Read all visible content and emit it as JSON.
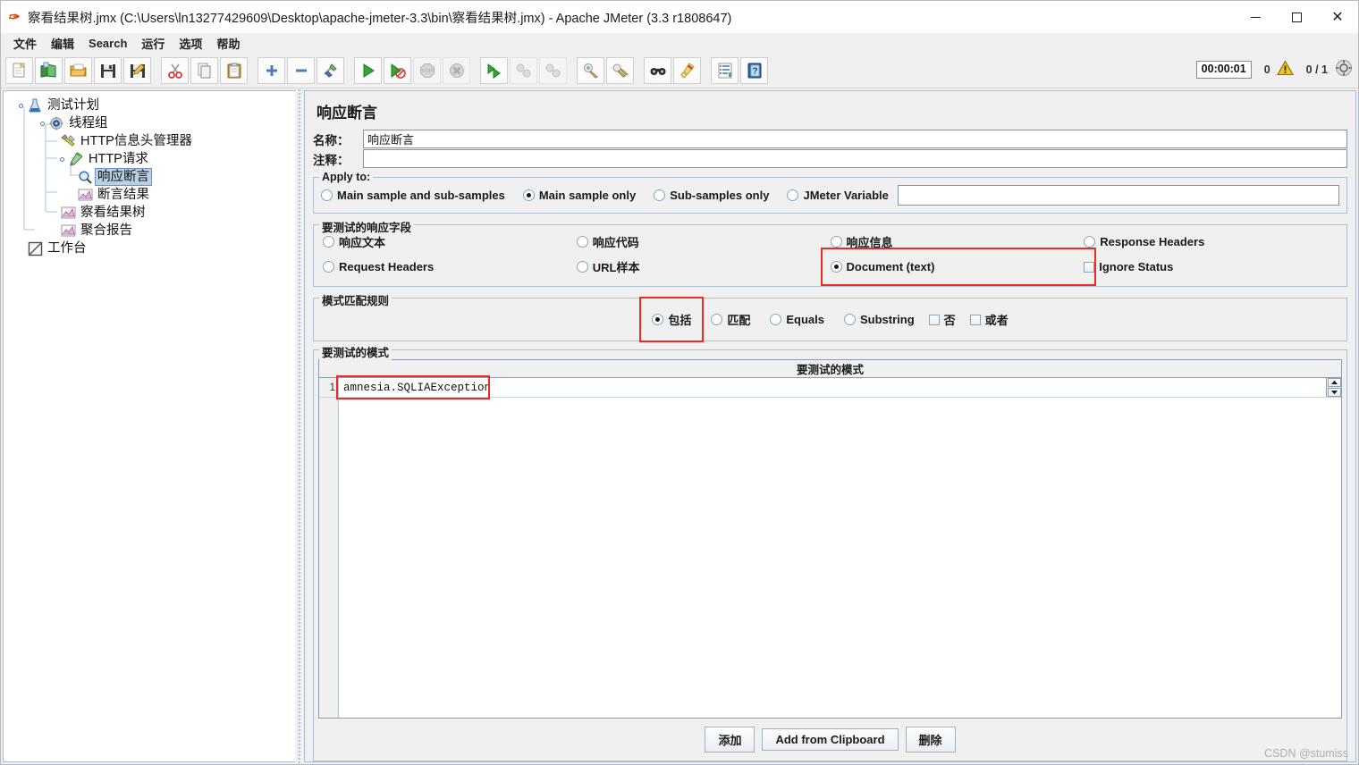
{
  "window": {
    "title": "察看结果树.jmx (C:\\Users\\ln13277429609\\Desktop\\apache-jmeter-3.3\\bin\\察看结果树.jmx) - Apache JMeter (3.3 r1808647)",
    "app_icon": "jmeter-feather-icon",
    "minimize_label": "",
    "maximize_label": "",
    "close_label": "✕"
  },
  "menubar": {
    "items": [
      {
        "label": "文件",
        "name": "menu-file"
      },
      {
        "label": "编辑",
        "name": "menu-edit"
      },
      {
        "label": "Search",
        "name": "menu-search"
      },
      {
        "label": "运行",
        "name": "menu-run"
      },
      {
        "label": "选项",
        "name": "menu-options"
      },
      {
        "label": "帮助",
        "name": "menu-help"
      }
    ]
  },
  "toolbar": {
    "buttons": [
      {
        "name": "new-icon",
        "group": 1
      },
      {
        "name": "templates-icon",
        "group": 1
      },
      {
        "name": "open-icon",
        "group": 1
      },
      {
        "name": "save-icon",
        "group": 1
      },
      {
        "name": "save-as-icon",
        "group": 1
      },
      {
        "name": "cut-icon",
        "group": 2
      },
      {
        "name": "copy-icon",
        "group": 2
      },
      {
        "name": "paste-icon",
        "group": 2
      },
      {
        "name": "expand-all-icon",
        "group": 3
      },
      {
        "name": "collapse-all-icon",
        "group": 3
      },
      {
        "name": "toggle-icon",
        "group": 3
      },
      {
        "name": "start-icon",
        "group": 4
      },
      {
        "name": "start-no-pause-icon",
        "group": 4
      },
      {
        "name": "stop-icon",
        "group": 4
      },
      {
        "name": "shutdown-icon",
        "group": 4
      },
      {
        "name": "start-remote-icon",
        "group": 5
      },
      {
        "name": "stop-remote-icon",
        "group": 5
      },
      {
        "name": "shutdown-remote-icon",
        "group": 5
      },
      {
        "name": "clear-icon",
        "group": 6
      },
      {
        "name": "clear-all-icon",
        "group": 6
      },
      {
        "name": "search-icon",
        "group": 7
      },
      {
        "name": "search-reset-icon",
        "group": 7
      },
      {
        "name": "function-helper-icon",
        "group": 8
      },
      {
        "name": "help-icon",
        "group": 8
      }
    ],
    "status": {
      "elapsed_time": "00:00:01",
      "warning_count": "0",
      "warning_icon": "warning-triangle-icon",
      "threads_ratio": "0 / 1",
      "remote_icon": "remote-status-icon"
    }
  },
  "tree": {
    "nodes": [
      {
        "label": "测试计划",
        "icon": "test-plan-icon",
        "depth": 0,
        "selected": false,
        "handle": true
      },
      {
        "label": "线程组",
        "icon": "thread-group-icon",
        "depth": 1,
        "selected": false,
        "handle": true
      },
      {
        "label": "HTTP信息头管理器",
        "icon": "header-manager-icon",
        "depth": 2,
        "selected": false,
        "handle": false
      },
      {
        "label": "HTTP请求",
        "icon": "http-request-icon",
        "depth": 2,
        "selected": false,
        "handle": true
      },
      {
        "label": "响应断言",
        "icon": "assertion-icon",
        "depth": 3,
        "selected": true,
        "handle": false
      },
      {
        "label": "断言结果",
        "icon": "listener-icon",
        "depth": 3,
        "selected": false,
        "handle": false
      },
      {
        "label": "察看结果树",
        "icon": "listener-icon",
        "depth": 2,
        "selected": false,
        "handle": false
      },
      {
        "label": "聚合报告",
        "icon": "listener-icon",
        "depth": 2,
        "selected": false,
        "handle": false
      },
      {
        "label": "工作台",
        "icon": "workbench-icon",
        "depth": 0,
        "selected": false,
        "handle": false
      }
    ]
  },
  "main": {
    "panel_title": "响应断言",
    "name_label": "名称：",
    "name_value": "响应断言",
    "comment_label": "注释：",
    "comment_value": "",
    "apply_to": {
      "legend": "Apply to:",
      "options": [
        {
          "label": "Main sample and sub-samples",
          "name": "radio-main-and-sub",
          "checked": false
        },
        {
          "label": "Main sample only",
          "name": "radio-main-only",
          "checked": true
        },
        {
          "label": "Sub-samples only",
          "name": "radio-sub-only",
          "checked": false
        },
        {
          "label": "JMeter Variable",
          "name": "radio-jmeter-variable",
          "checked": false
        }
      ],
      "variable_value": ""
    },
    "response_field": {
      "legend": "要测试的响应字段",
      "options": [
        {
          "label": "响应文本",
          "name": "radio-response-text",
          "type": "radio",
          "checked": false,
          "highlighted": false
        },
        {
          "label": "响应代码",
          "name": "radio-response-code",
          "type": "radio",
          "checked": false,
          "highlighted": false
        },
        {
          "label": "响应信息",
          "name": "radio-response-message",
          "type": "radio",
          "checked": false,
          "highlighted": false
        },
        {
          "label": "Response Headers",
          "name": "radio-response-headers",
          "type": "radio",
          "checked": false,
          "highlighted": false
        },
        {
          "label": "Request Headers",
          "name": "radio-request-headers",
          "type": "radio",
          "checked": false,
          "highlighted": false
        },
        {
          "label": "URL样本",
          "name": "radio-url-sample",
          "type": "radio",
          "checked": false,
          "highlighted": false
        },
        {
          "label": "Document (text)",
          "name": "radio-document-text",
          "type": "radio",
          "checked": true,
          "highlighted": true
        },
        {
          "label": "Ignore Status",
          "name": "checkbox-ignore-status",
          "type": "checkbox",
          "checked": false,
          "highlighted": false
        }
      ]
    },
    "pattern_rules": {
      "legend": "模式匹配规则",
      "options": [
        {
          "label": "包括",
          "name": "radio-contains",
          "type": "radio",
          "checked": true,
          "highlighted": true
        },
        {
          "label": "匹配",
          "name": "radio-matches",
          "type": "radio",
          "checked": false,
          "highlighted": false
        },
        {
          "label": "Equals",
          "name": "radio-equals",
          "type": "radio",
          "checked": false,
          "highlighted": false
        },
        {
          "label": "Substring",
          "name": "radio-substring",
          "type": "radio",
          "checked": false,
          "highlighted": false
        },
        {
          "label": "否",
          "name": "checkbox-not",
          "type": "checkbox",
          "checked": false,
          "highlighted": false
        },
        {
          "label": "或者",
          "name": "checkbox-or",
          "type": "checkbox",
          "checked": false,
          "highlighted": false
        }
      ]
    },
    "patterns": {
      "legend": "要测试的模式",
      "column_header": "要测试的模式",
      "rows": [
        {
          "index": "1",
          "value": "amnesia.SQLIAException",
          "highlighted": true
        }
      ],
      "scroll_up_icon": "spinner-up-icon",
      "scroll_down_icon": "spinner-down-icon"
    },
    "buttons": [
      {
        "label": "添加",
        "name": "add-button"
      },
      {
        "label": "Add from Clipboard",
        "name": "add-from-clipboard-button"
      },
      {
        "label": "删除",
        "name": "delete-button"
      }
    ]
  },
  "watermark": "CSDN @stumiss",
  "colors": {
    "highlight": "#ee2b22",
    "selection": "#b8cfe5",
    "panel_bg": "#f0f0f0",
    "border": "#adbfd0"
  }
}
